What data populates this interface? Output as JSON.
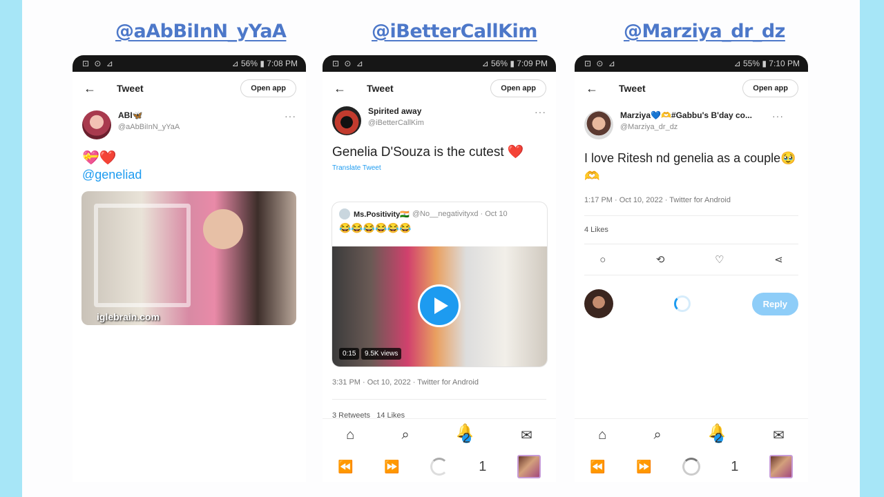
{
  "colors": {
    "accent": "#1d9bf0",
    "handle": "#4d78c9",
    "background": "#a7e6f7"
  },
  "panels": [
    {
      "handle": "@aAbBiInN_yYaA",
      "status_time": "7:08 PM",
      "battery": "56%",
      "topbar": {
        "title": "Tweet",
        "open_app": "Open app"
      },
      "author": {
        "name": "ABI🦋",
        "username": "@aAbBiInN_yYaA"
      },
      "emoji_text": "💝❤️",
      "mention": "@geneliad",
      "watermark": "iglebrain.com"
    },
    {
      "handle": "@iBetterCallKim",
      "status_time": "7:09 PM",
      "battery": "56%",
      "topbar": {
        "title": "Tweet",
        "open_app": "Open app"
      },
      "author": {
        "name": "Spirited away",
        "username": "@iBetterCallKim"
      },
      "tweet_text": "Genelia D'Souza is the cutest ❤️",
      "translate": "Translate Tweet",
      "quote": {
        "name": "Ms.Positivity🇮🇳",
        "username": "@No__negativityxd",
        "date": "· Oct 10",
        "text": "😂😂😂😂😂😂"
      },
      "video": {
        "duration": "0:15",
        "views": "9.5K views"
      },
      "timestamp": "3:31 PM · Oct 10, 2022 · Twitter for Android",
      "stats": "3 Retweets   14 Likes",
      "notif_badge": "2",
      "tab_count": "1"
    },
    {
      "handle": "@Marziya_dr_dz",
      "status_time": "7:10 PM",
      "battery": "55%",
      "topbar": {
        "title": "Tweet",
        "open_app": "Open app"
      },
      "author": {
        "name": "Marziya💙🫶#Gabbu's B'day co...",
        "username": "@Marziya_dr_dz"
      },
      "tweet_text": "I love Ritesh nd genelia as a couple🥹🫶",
      "timestamp": "1:17 PM · Oct 10, 2022 · Twitter for Android",
      "likes": "4 Likes",
      "reply_label": "Reply",
      "notif_badge": "2",
      "tab_count": "1"
    }
  ],
  "icons": {
    "back": "←",
    "more": "···",
    "home": "⌂",
    "search": "⌕",
    "bell": "🔔",
    "mail": "✉",
    "prev": "⏪",
    "next": "⏩",
    "reply": "○",
    "retweet": "⟲",
    "like": "♡",
    "share": "⋖"
  }
}
